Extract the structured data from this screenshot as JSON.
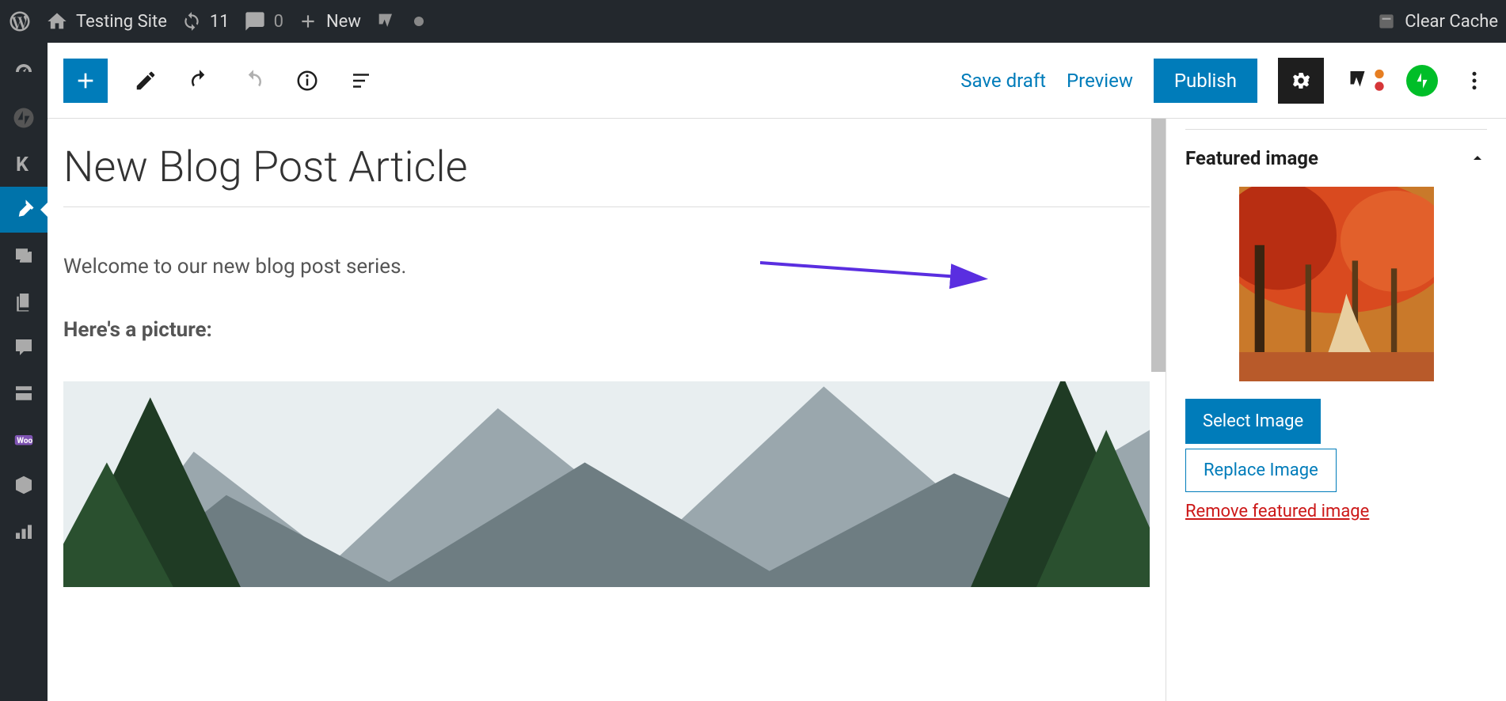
{
  "adminbar": {
    "site_name": "Testing Site",
    "updates_count": "11",
    "comments_count": "0",
    "new_label": "New",
    "clear_cache": "Clear Cache"
  },
  "editor_toolbar": {
    "save_draft": "Save draft",
    "preview": "Preview",
    "publish": "Publish"
  },
  "post": {
    "title": "New Blog Post Article",
    "paragraph1": "Welcome to our new blog post series.",
    "paragraph2": "Here's a picture:"
  },
  "sidebar_panel": {
    "title": "Featured image",
    "select_btn": "Select Image",
    "replace_btn": "Replace Image",
    "remove_link": "Remove featured image"
  }
}
